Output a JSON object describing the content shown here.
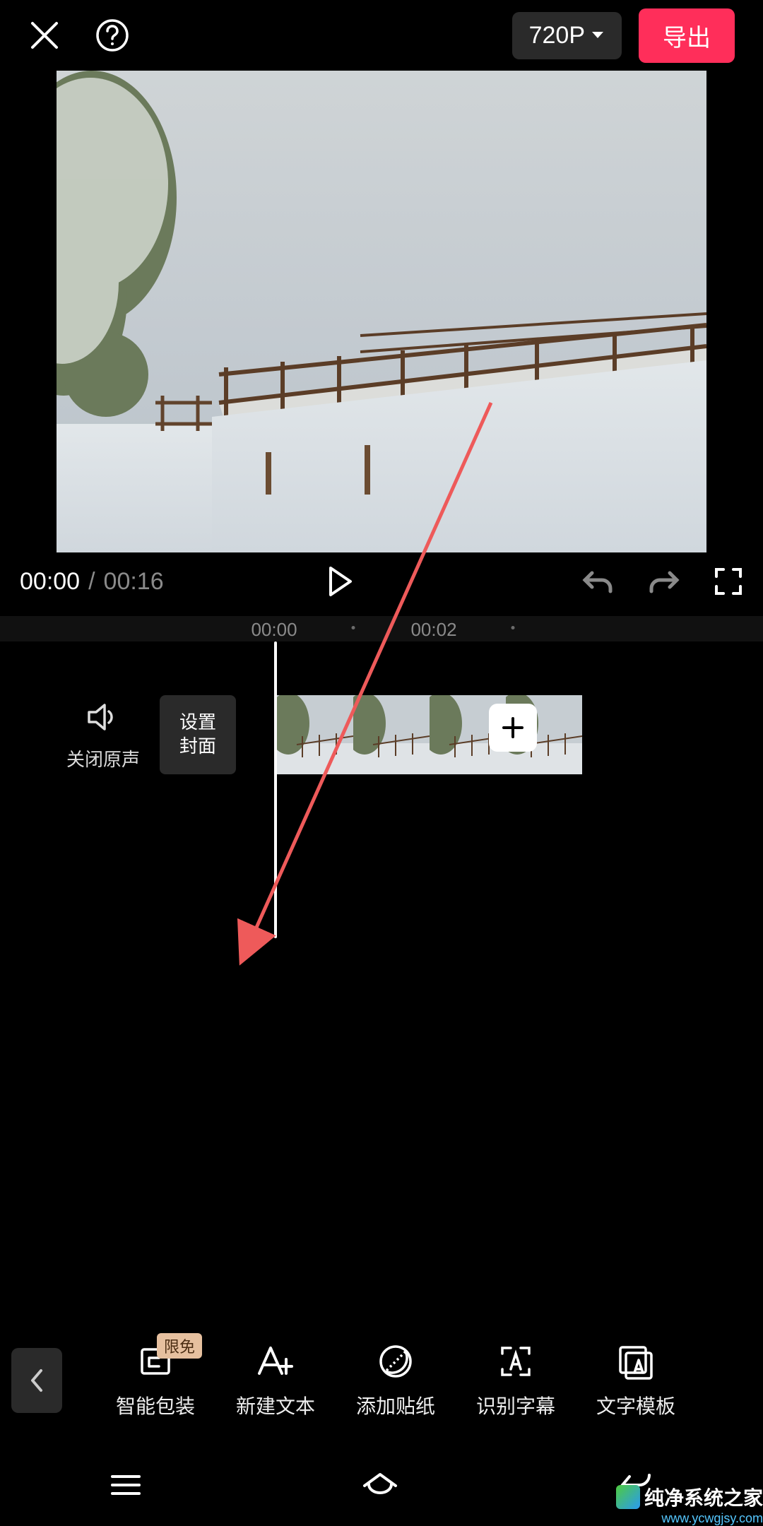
{
  "topbar": {
    "resolution_label": "720P",
    "export_label": "导出"
  },
  "controls": {
    "current_time": "00:00",
    "separator": "/",
    "total_time": "00:16"
  },
  "ruler": {
    "ticks": [
      "00:00",
      "00:02"
    ]
  },
  "timeline": {
    "mute_label": "关闭原声",
    "cover_line1": "设置",
    "cover_line2": "封面"
  },
  "tools": {
    "badge": "限免",
    "items": [
      {
        "id": "smart-pack",
        "label": "智能包装"
      },
      {
        "id": "new-text",
        "label": "新建文本"
      },
      {
        "id": "add-sticker",
        "label": "添加贴纸"
      },
      {
        "id": "subtitle",
        "label": "识别字幕"
      },
      {
        "id": "text-template",
        "label": "文字模板"
      }
    ]
  },
  "watermark": {
    "text": "纯净系统之家",
    "url": "www.ycwgjsy.com"
  },
  "colors": {
    "accent": "#ff2e5a",
    "badge_bg": "#e6c09f",
    "muted": "#8a8a8a"
  }
}
